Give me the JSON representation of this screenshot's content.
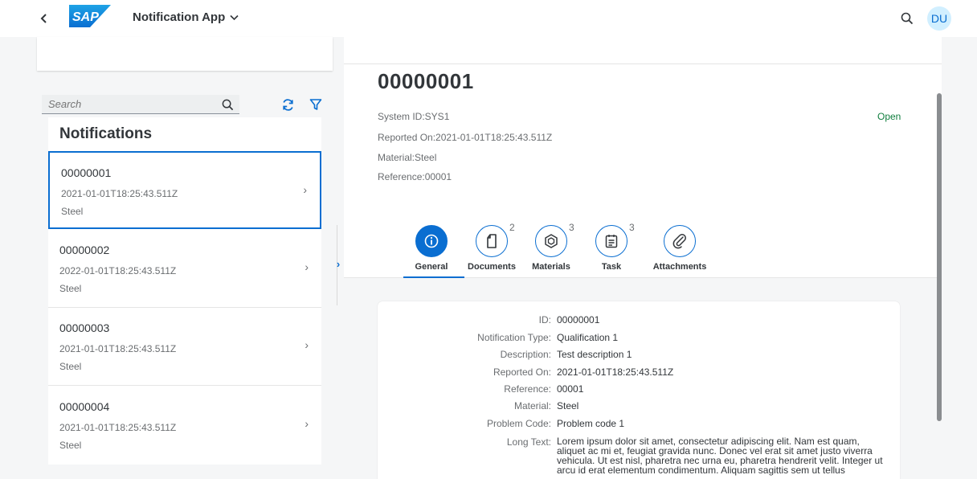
{
  "shell": {
    "app_title": "Notification App",
    "avatar_initials": "DU",
    "logo_text": "SAP"
  },
  "master": {
    "search_placeholder": "Search",
    "title": "Notifications",
    "items": [
      {
        "id": "00000001",
        "date": "2021-01-01T18:25:43.511Z",
        "material": "Steel",
        "selected": true
      },
      {
        "id": "00000002",
        "date": "2022-01-01T18:25:43.511Z",
        "material": "Steel",
        "selected": false
      },
      {
        "id": "00000003",
        "date": "2021-01-01T18:25:43.511Z",
        "material": "Steel",
        "selected": false
      },
      {
        "id": "00000004",
        "date": "2021-01-01T18:25:43.511Z",
        "material": "Steel",
        "selected": false
      }
    ]
  },
  "detail": {
    "title": "00000001",
    "status": "Open",
    "attributes": [
      "System ID:SYS1",
      "Reported On:2021-01-01T18:25:43.511Z",
      "Material:Steel",
      "Reference:00001"
    ],
    "tabs": [
      {
        "label": "General",
        "count": "",
        "icon": "info-icon",
        "active": true
      },
      {
        "label": "Documents",
        "count": "2",
        "icon": "document-icon",
        "active": false
      },
      {
        "label": "Materials",
        "count": "3",
        "icon": "materials-icon",
        "active": false
      },
      {
        "label": "Task",
        "count": "3",
        "icon": "task-icon",
        "active": false
      },
      {
        "label": "Attachments",
        "count": "",
        "icon": "paperclip-icon",
        "active": false
      }
    ],
    "general": {
      "fields": [
        {
          "label": "ID:",
          "value": "00000001"
        },
        {
          "label": "Notification Type:",
          "value": "Qualification 1"
        },
        {
          "label": "Description:",
          "value": "Test description 1"
        },
        {
          "label": "Reported On:",
          "value": "2021-01-01T18:25:43.511Z"
        },
        {
          "label": "Reference:",
          "value": "00001"
        },
        {
          "label": "Material:",
          "value": "Steel"
        },
        {
          "label": "Problem Code:",
          "value": "Problem code 1"
        }
      ],
      "long_text_label": "Long Text:",
      "long_text": "Lorem ipsum dolor sit amet, consectetur adipiscing elit. Nam est quam, aliquet ac mi et, feugiat gravida nunc. Donec vel erat sit amet justo viverra vehicula. Ut est nisl, pharetra nec urna eu, pharetra hendrerit velit. Integer ut arcu id erat elementum condimentum. Aliquam sagittis sem ut tellus"
    }
  },
  "colors": {
    "accent": "#0a6ed1",
    "status_positive": "#107e3e",
    "avatar_bg": "#d1efff"
  }
}
